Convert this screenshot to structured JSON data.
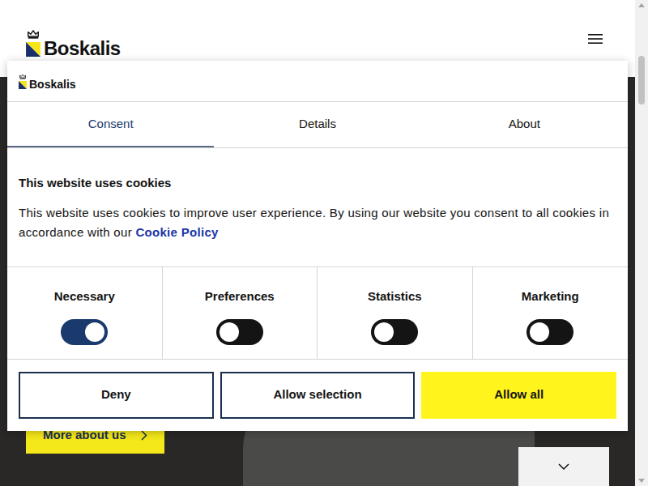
{
  "header": {
    "logo": "Boskalis"
  },
  "hero": {
    "button": "More about us"
  },
  "dialog": {
    "logo": "Boskalis",
    "tabs": [
      {
        "label": "Consent",
        "selected": true
      },
      {
        "label": "Details",
        "selected": false
      },
      {
        "label": "About",
        "selected": false
      }
    ],
    "heading": "This website uses cookies",
    "text": "This website uses cookies to improve user experience. By using our website you consent to all cookies in accordance with our ",
    "link": "Cookie Policy",
    "categories": [
      {
        "label": "Necessary",
        "on": true
      },
      {
        "label": "Preferences",
        "on": false
      },
      {
        "label": "Statistics",
        "on": false
      },
      {
        "label": "Marketing",
        "on": false
      }
    ],
    "buttons": [
      "Deny",
      "Allow selection",
      "Allow all"
    ]
  }
}
